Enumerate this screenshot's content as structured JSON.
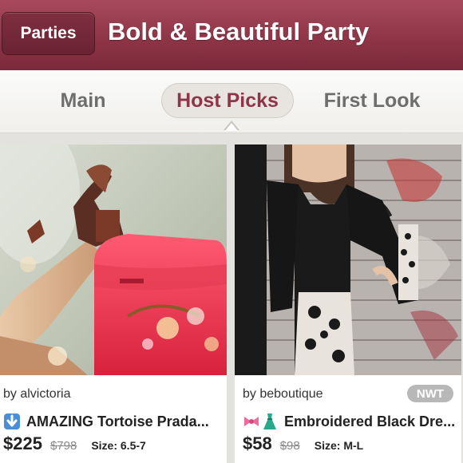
{
  "header": {
    "back_label": "Parties",
    "title": "Bold & Beautiful Party"
  },
  "tabs": [
    {
      "label": "Main"
    },
    {
      "label": "Host Picks",
      "selected": true
    },
    {
      "label": "First Look"
    }
  ],
  "listings": [
    {
      "byline": "by alvictoria",
      "icons": [
        "down-arrow-emoji"
      ],
      "title": "AMAZING Tortoise Prada...",
      "price": "$225",
      "original_price": "$798",
      "size": "Size: 6.5-7"
    },
    {
      "byline": "by beboutique",
      "badge": "NWT",
      "icons": [
        "ribbon-emoji",
        "dress-emoji"
      ],
      "title": "Embroidered Black Dre...",
      "price": "$58",
      "original_price": "$98",
      "size": "Size: M-L"
    }
  ],
  "colors": {
    "header": "#8e3547",
    "selected_tab_text": "#8e3547",
    "badge": "#b8b8b8"
  }
}
